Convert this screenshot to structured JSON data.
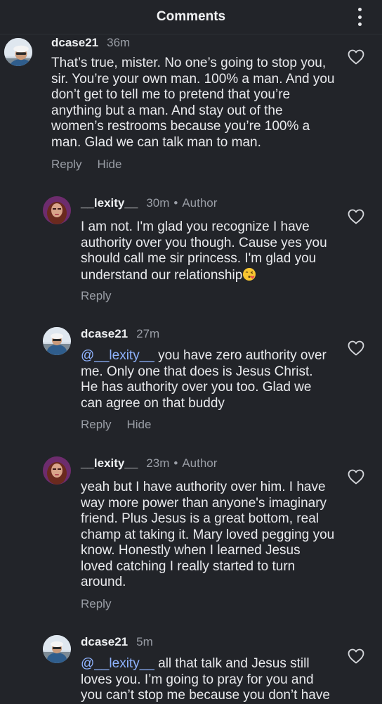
{
  "header": {
    "title": "Comments"
  },
  "comments": [
    {
      "user": "dcase21",
      "time": "36m",
      "text": "That’s true, mister. No one’s going to stop you, sir. You’re your own man. 100% a man. And you don’t get to tell me to pretend that you’re anything but a man. And stay out of the women’s restrooms because you’re 100% a man. Glad we can talk man to man.",
      "reply": "Reply",
      "hide": "Hide"
    },
    {
      "user": "__lexity__",
      "time": "30m",
      "dot": "•",
      "role": "Author",
      "text": "I am not. I'm glad you recognize I have authority over you though. Cause yes you should call me sir princess. I'm glad you understand our relationship",
      "emoji": "kissing-face-emoji",
      "reply": "Reply"
    },
    {
      "user": "dcase21",
      "time": "27m",
      "mention": "@__lexity__",
      "text": "you have zero authority over me. Only one that does is Jesus Christ. He has authority over you too. Glad we can agree on that buddy",
      "reply": "Reply",
      "hide": "Hide"
    },
    {
      "user": "__lexity__",
      "time": "23m",
      "dot": "•",
      "role": "Author",
      "text": "yeah but I have authority over him. I have way more power than anyone's imaginary friend. Plus Jesus is a great bottom, real champ at taking it. Mary loved pegging you know. Honestly when I learned Jesus loved catching I really started to turn around.",
      "reply": "Reply"
    },
    {
      "user": "dcase21",
      "time": "5m",
      "mention": "@__lexity__",
      "text": "all that talk and Jesus still loves you. I’m going to pray for you and you can’t stop me because you don’t have"
    }
  ],
  "icons": {
    "more": "more-vertical-icon",
    "like": "heart-outline-icon"
  },
  "colors": {
    "background": "#222429",
    "mention": "#8fb3ff",
    "muted": "#9a9ea6"
  }
}
